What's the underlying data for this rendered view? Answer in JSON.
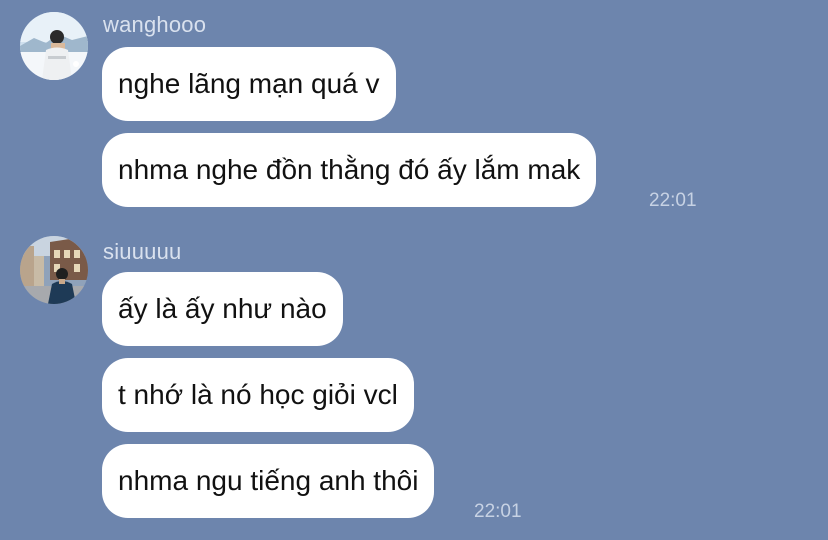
{
  "chat": {
    "background_color": "#6d85ad",
    "groups": [
      {
        "sender": "wanghooo",
        "avatar_icon": "user-photo-avatar-snow",
        "messages": [
          "nghe lãng mạn quá v",
          "nhma nghe đồn thằng đó ấy lắm mak"
        ],
        "time": "22:01"
      },
      {
        "sender": "siuuuuu",
        "avatar_icon": "user-photo-avatar-street",
        "messages": [
          "ấy là ấy như nào",
          "t nhớ là nó học giỏi vcl",
          "nhma ngu tiếng anh thôi"
        ],
        "time": "22:01"
      }
    ]
  }
}
